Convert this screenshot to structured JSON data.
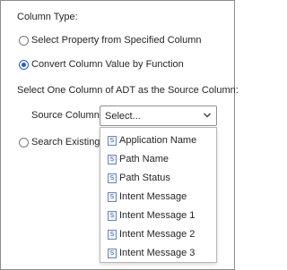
{
  "form": {
    "column_type_label": "Column Type:",
    "options": [
      {
        "label": "Select Property from Specified Column",
        "checked": false
      },
      {
        "label": "Convert Column Value by Function",
        "checked": true
      },
      {
        "label": "Search Existing M",
        "checked": false
      }
    ],
    "source_prompt": "Select One Column of ADT as the Source Column:",
    "source_column_label": "Source Column:",
    "source_select_value": "Select...",
    "dropdown_items": [
      {
        "icon": "S",
        "label": "Application Name"
      },
      {
        "icon": "S",
        "label": "Path Name"
      },
      {
        "icon": "S",
        "label": "Path Status"
      },
      {
        "icon": "S",
        "label": "Intent Message"
      },
      {
        "icon": "S",
        "label": "Intent Message 1"
      },
      {
        "icon": "S",
        "label": "Intent Message 2"
      },
      {
        "icon": "S",
        "label": "Intent Message 3"
      }
    ]
  },
  "colors": {
    "accent": "#2160c4",
    "border": "#8c8c8c"
  }
}
